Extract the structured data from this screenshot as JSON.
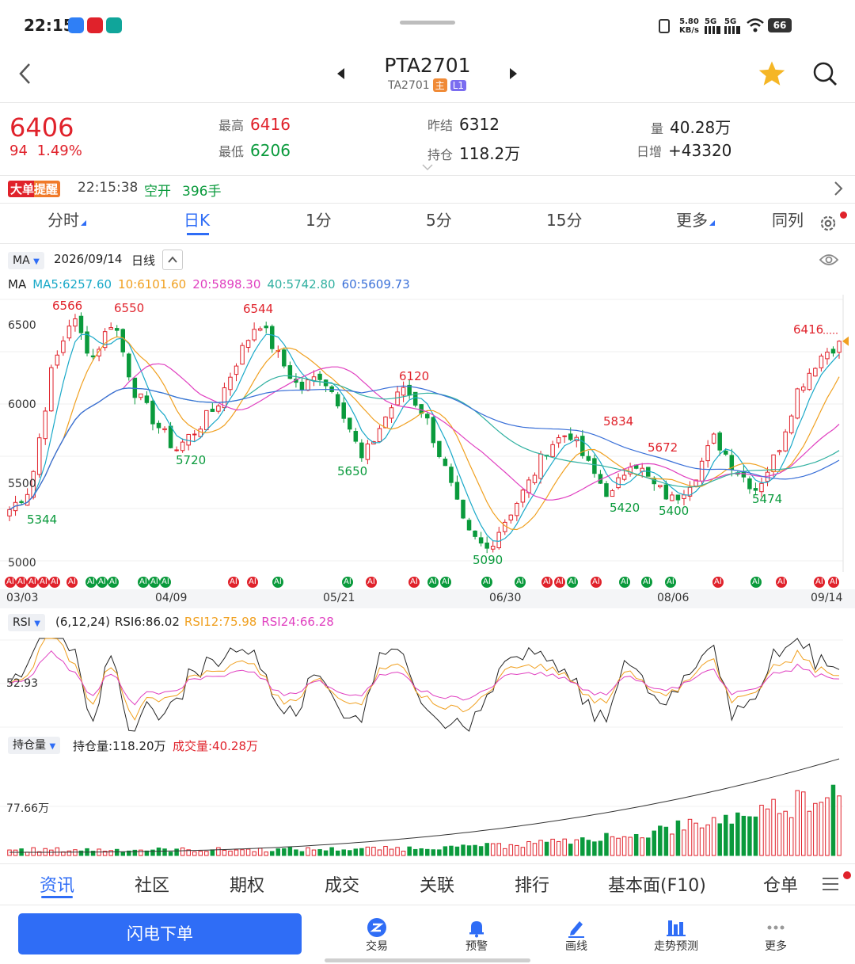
{
  "status_bar": {
    "time": "22:15",
    "net_speed_value": "5.80",
    "net_speed_unit": "KB/s",
    "signal1": "5G",
    "signal2": "5G",
    "battery": "66"
  },
  "header": {
    "title": "PTA2701",
    "code": "TA2701",
    "badge_main": "主",
    "badge_level": "L1"
  },
  "quote": {
    "price": "6406",
    "change": "94",
    "change_pct": "1.49%",
    "high_label": "最高",
    "high": "6416",
    "low_label": "最低",
    "low": "6206",
    "prev_settle_label": "昨结",
    "prev_settle": "6312",
    "open_interest_label": "持仓",
    "open_interest": "118.2万",
    "volume_label": "量",
    "volume": "40.28万",
    "daily_inc_label": "日增",
    "daily_inc": "+43320"
  },
  "alert": {
    "label": "大单提醒",
    "time": "22:15:38",
    "type": "空开",
    "qty": "396手"
  },
  "period_tabs": [
    "分时",
    "日K",
    "1分",
    "5分",
    "15分",
    "更多",
    "同列"
  ],
  "active_tab_index": 1,
  "ma_bar": {
    "indicator": "MA",
    "date": "2026/09/14",
    "period": "日线"
  },
  "ma_values": {
    "label": "MA",
    "ma5": "MA5:6257.60",
    "ma10": "10:6101.60",
    "ma20": "20:5898.30",
    "ma40": "40:5742.80",
    "ma60": "60:5609.73"
  },
  "ai_tag": "AI",
  "colors": {
    "up": "#e0222b",
    "down": "#0a9a3c",
    "ma5": "#1aa9c8",
    "ma10": "#f0a020",
    "ma20": "#e040c0",
    "ma40": "#30b0a0",
    "ma60": "#3a70d8",
    "accent": "#2f6df6"
  },
  "chart_data": [
    {
      "type": "candlestick",
      "y_ticks": [
        "6500",
        "6000",
        "5500",
        "5000"
      ],
      "ylim": [
        4990,
        6600
      ],
      "x_ticks": [
        "03/03",
        "04/09",
        "05/21",
        "06/30",
        "08/06",
        "09/14"
      ],
      "annotations": [
        {
          "text": "6566",
          "kind": "high"
        },
        {
          "text": "6550",
          "kind": "high"
        },
        {
          "text": "6544",
          "kind": "high"
        },
        {
          "text": "6120",
          "kind": "high"
        },
        {
          "text": "5834",
          "kind": "high"
        },
        {
          "text": "5672",
          "kind": "high"
        },
        {
          "text": "6416",
          "kind": "high"
        },
        {
          "text": "5344",
          "kind": "low"
        },
        {
          "text": "5720",
          "kind": "low"
        },
        {
          "text": "5650",
          "kind": "low"
        },
        {
          "text": "5090",
          "kind": "low"
        },
        {
          "text": "5420",
          "kind": "low"
        },
        {
          "text": "5400",
          "kind": "low"
        },
        {
          "text": "5474",
          "kind": "low"
        }
      ],
      "anchors": [
        5344,
        5480,
        6200,
        6566,
        6300,
        6550,
        6100,
        5900,
        5720,
        5850,
        6000,
        6300,
        6544,
        6300,
        6100,
        6200,
        6000,
        5650,
        5900,
        6120,
        5950,
        5600,
        5200,
        5090,
        5300,
        5500,
        5750,
        5834,
        5600,
        5420,
        5672,
        5500,
        5400,
        5550,
        5800,
        5600,
        5474,
        5700,
        6100,
        6300,
        6406
      ]
    },
    {
      "type": "line",
      "title": "RSI",
      "params": "(6,12,24)",
      "series": [
        {
          "name": "RSI6",
          "value_text": "RSI6:86.02"
        },
        {
          "name": "RSI12",
          "value_text": "RSI12:75.98"
        },
        {
          "name": "RSI24",
          "value_text": "RSI24:66.28"
        }
      ],
      "y_tick": "52.93"
    },
    {
      "type": "bar",
      "title": "持仓量",
      "open_interest_text": "持仓量:118.20万",
      "volume_text": "成交量:40.28万",
      "y_tick": "77.66万"
    }
  ],
  "bottom_tabs": [
    "资讯",
    "社区",
    "期权",
    "成交",
    "关联",
    "排行",
    "基本面(F10)",
    "仓单"
  ],
  "actions": {
    "flash_order": "闪电下单",
    "trade": "交易",
    "alert": "预警",
    "draw": "画线",
    "trend": "走势预测",
    "more": "更多"
  }
}
